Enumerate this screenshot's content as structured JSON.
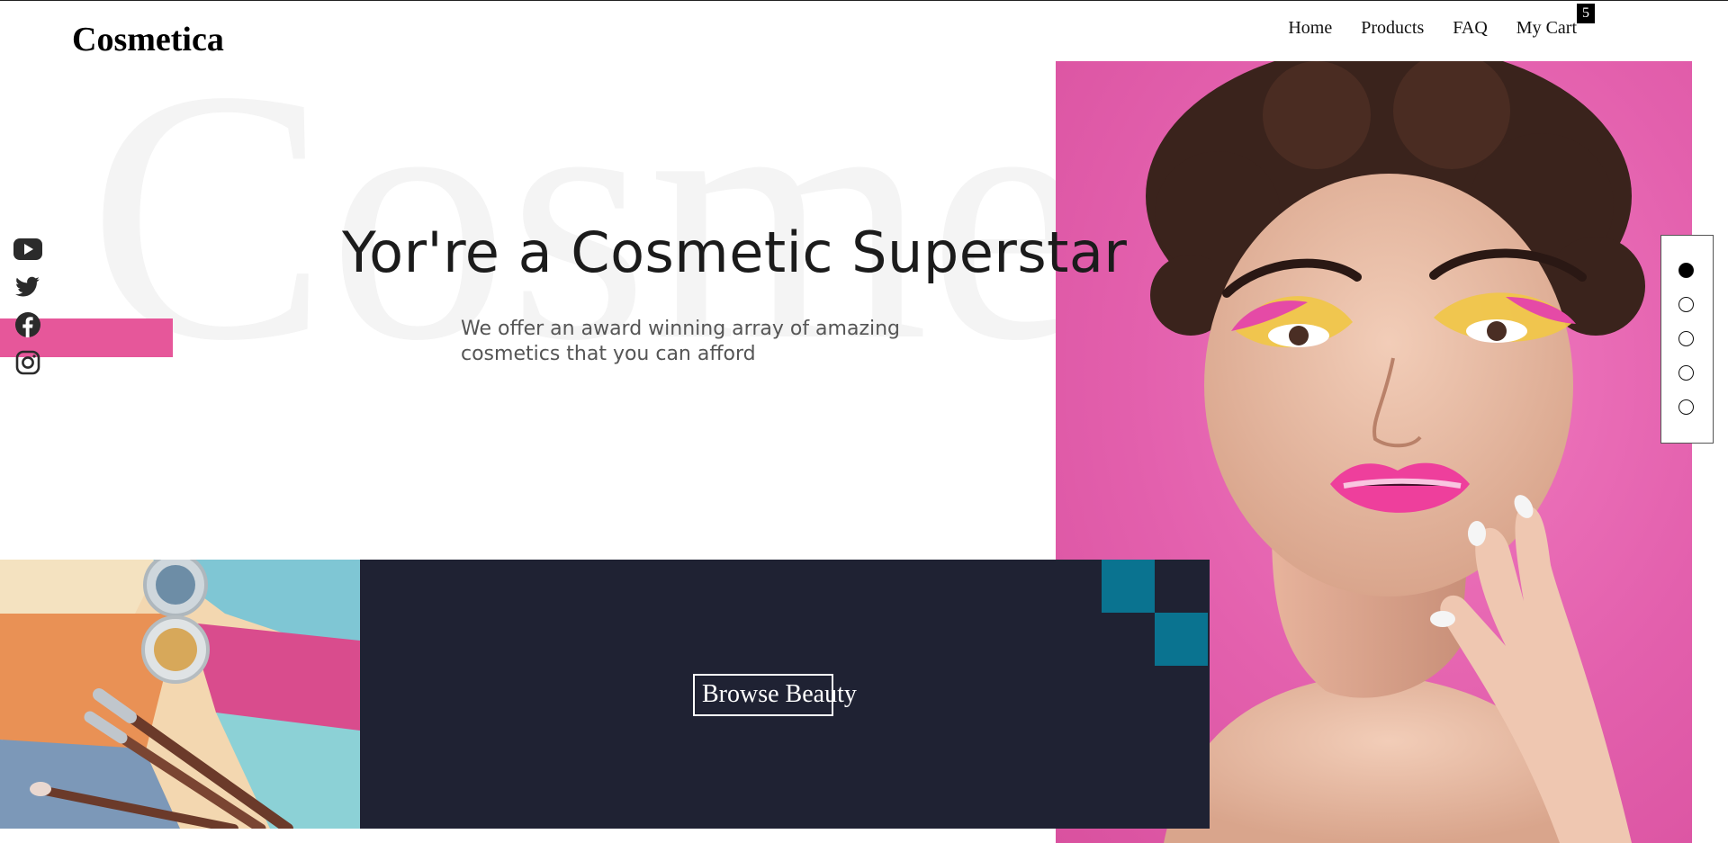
{
  "brand": {
    "name": "Cosmetica"
  },
  "nav": {
    "items": [
      {
        "label": "Home"
      },
      {
        "label": "Products"
      },
      {
        "label": "FAQ"
      },
      {
        "label": "My Cart"
      }
    ],
    "cart_count": "5"
  },
  "hero": {
    "background_word": "Cosmetica",
    "title": "Yor're a Cosmetic Superstar",
    "subtitle": "We offer an award winning array of amazing cosmetics that you can afford"
  },
  "social": {
    "icons": [
      "youtube-icon",
      "twitter-icon",
      "facebook-icon",
      "instagram-icon"
    ]
  },
  "slider": {
    "total": 5,
    "active_index": 0
  },
  "cta": {
    "label": "Browse Beauty"
  },
  "colors": {
    "accent_pink": "#e6579a",
    "model_background": "#e360ad",
    "dark_panel": "#1f2233",
    "teal": "#0a7390"
  }
}
